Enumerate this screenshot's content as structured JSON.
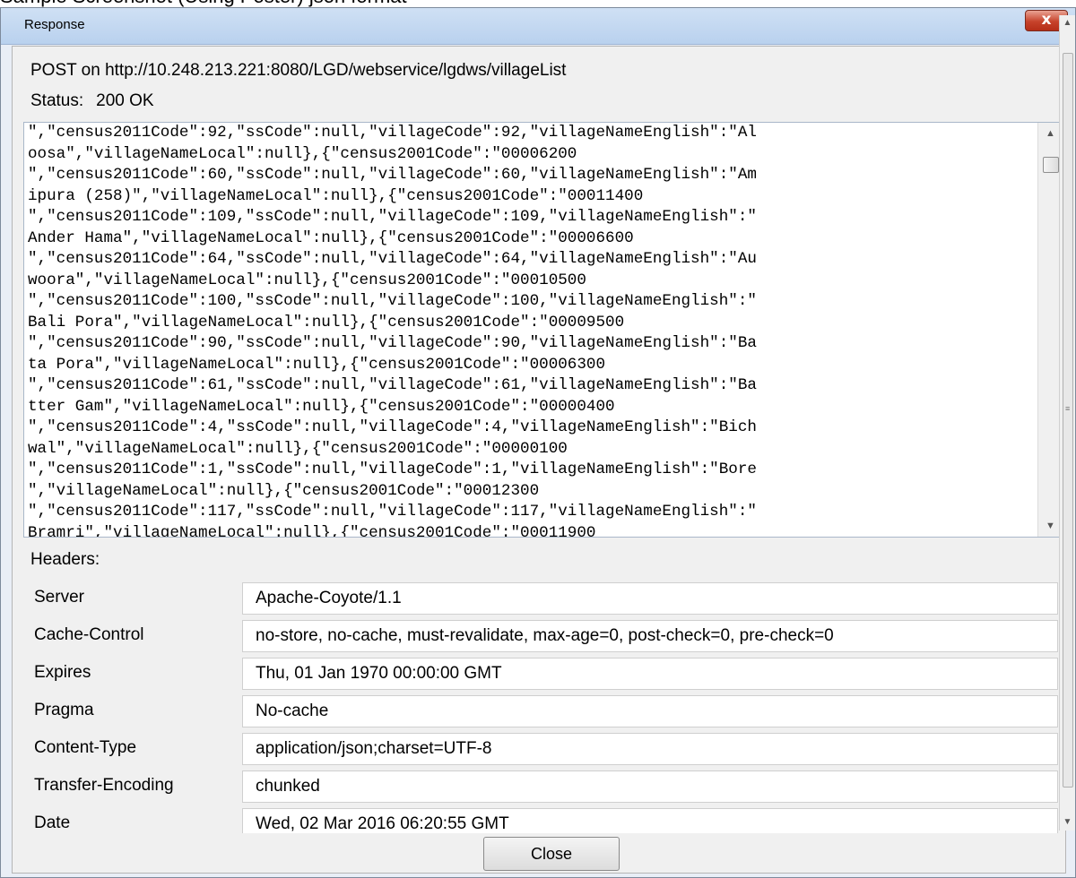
{
  "caption": "Sample Screenshot (Using Poster) json format",
  "window": {
    "title": "Response",
    "close_glyph": "x"
  },
  "request": {
    "line": "POST on http://10.248.213.221:8080/LGD/webservice/lgdws/villageList",
    "status_label": "Status:",
    "status_value": "200 OK"
  },
  "body_lines": [
    "\",\"census2011Code\":92,\"ssCode\":null,\"villageCode\":92,\"villageNameEnglish\":\"Al",
    "oosa\",\"villageNameLocal\":null},{\"census2001Code\":\"00006200",
    "\",\"census2011Code\":60,\"ssCode\":null,\"villageCode\":60,\"villageNameEnglish\":\"Am",
    "ipura (258)\",\"villageNameLocal\":null},{\"census2001Code\":\"00011400",
    "\",\"census2011Code\":109,\"ssCode\":null,\"villageCode\":109,\"villageNameEnglish\":\"",
    "Ander Hama\",\"villageNameLocal\":null},{\"census2001Code\":\"00006600",
    "\",\"census2011Code\":64,\"ssCode\":null,\"villageCode\":64,\"villageNameEnglish\":\"Au",
    "woora\",\"villageNameLocal\":null},{\"census2001Code\":\"00010500",
    "\",\"census2011Code\":100,\"ssCode\":null,\"villageCode\":100,\"villageNameEnglish\":\"",
    "Bali Pora\",\"villageNameLocal\":null},{\"census2001Code\":\"00009500",
    "\",\"census2011Code\":90,\"ssCode\":null,\"villageCode\":90,\"villageNameEnglish\":\"Ba",
    "ta Pora\",\"villageNameLocal\":null},{\"census2001Code\":\"00006300",
    "\",\"census2011Code\":61,\"ssCode\":null,\"villageCode\":61,\"villageNameEnglish\":\"Ba",
    "tter Gam\",\"villageNameLocal\":null},{\"census2001Code\":\"00000400",
    "\",\"census2011Code\":4,\"ssCode\":null,\"villageCode\":4,\"villageNameEnglish\":\"Bich",
    "wal\",\"villageNameLocal\":null},{\"census2001Code\":\"00000100",
    "\",\"census2011Code\":1,\"ssCode\":null,\"villageCode\":1,\"villageNameEnglish\":\"Bore",
    "\",\"villageNameLocal\":null},{\"census2001Code\":\"00012300",
    "\",\"census2011Code\":117,\"ssCode\":null,\"villageCode\":117,\"villageNameEnglish\":\"",
    "Bramri\",\"villageNameLocal\":null},{\"census2001Code\":\"00011900"
  ],
  "headers": {
    "label": "Headers:",
    "rows": [
      {
        "key": "Server",
        "value": "Apache-Coyote/1.1"
      },
      {
        "key": "Cache-Control",
        "value": "no-store, no-cache, must-revalidate, max-age=0, post-check=0, pre-check=0"
      },
      {
        "key": "Expires",
        "value": "Thu, 01 Jan 1970 00:00:00 GMT"
      },
      {
        "key": "Pragma",
        "value": "No-cache"
      },
      {
        "key": "Content-Type",
        "value": "application/json;charset=UTF-8"
      },
      {
        "key": "Transfer-Encoding",
        "value": "chunked"
      },
      {
        "key": "Date",
        "value": "Wed, 02 Mar 2016 06:20:55 GMT"
      }
    ]
  },
  "buttons": {
    "close_label": "Close"
  },
  "icons": {
    "scroll_up": "scroll-up-arrow-icon",
    "scroll_down": "scroll-down-arrow-icon",
    "close": "close-icon"
  },
  "colors": {
    "titlebar": "#c4d8f1",
    "close_button_red": "#c7422b",
    "dialog_background": "#f0f0f0"
  }
}
